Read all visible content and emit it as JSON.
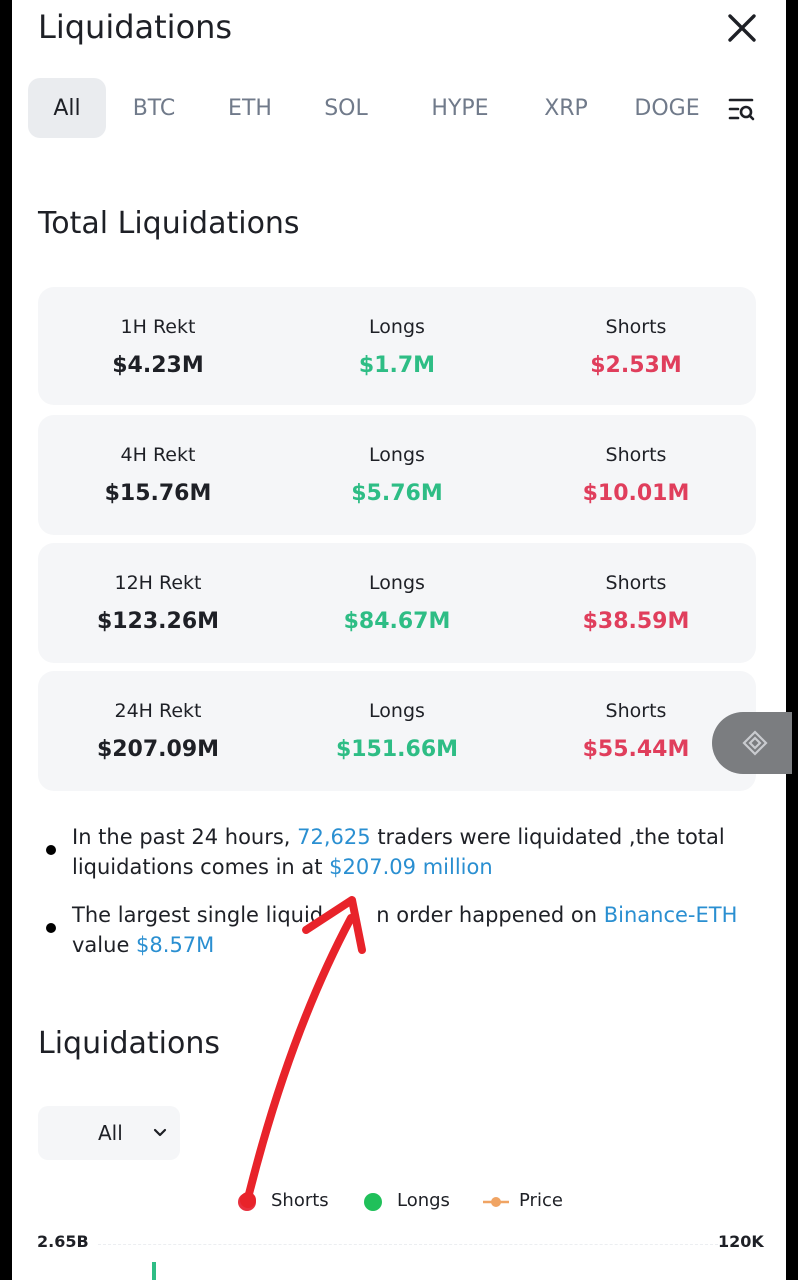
{
  "header": {
    "title": "Liquidations"
  },
  "tabs": [
    {
      "label": "All",
      "active": true
    },
    {
      "label": "BTC"
    },
    {
      "label": "ETH"
    },
    {
      "label": "SOL"
    },
    {
      "label": "HYPE"
    },
    {
      "label": "XRP"
    },
    {
      "label": "DOGE"
    }
  ],
  "total": {
    "title": "Total Liquidations",
    "rows": [
      {
        "rekt_label": "1H Rekt",
        "rekt_value": "$4.23M",
        "longs_label": "Longs",
        "longs_value": "$1.7M",
        "shorts_label": "Shorts",
        "shorts_value": "$2.53M"
      },
      {
        "rekt_label": "4H Rekt",
        "rekt_value": "$15.76M",
        "longs_label": "Longs",
        "longs_value": "$5.76M",
        "shorts_label": "Shorts",
        "shorts_value": "$10.01M"
      },
      {
        "rekt_label": "12H Rekt",
        "rekt_value": "$123.26M",
        "longs_label": "Longs",
        "longs_value": "$84.67M",
        "shorts_label": "Shorts",
        "shorts_value": "$38.59M"
      },
      {
        "rekt_label": "24H Rekt",
        "rekt_value": "$207.09M",
        "longs_label": "Longs",
        "longs_value": "$151.66M",
        "shorts_label": "Shorts",
        "shorts_value": "$55.44M"
      }
    ]
  },
  "summary": {
    "line1_pre": "In the past 24 hours, ",
    "line1_traders": "72,625",
    "line1_mid": " traders were liquidated ,the total liquidations comes in at ",
    "line1_amount": "$207.09 million",
    "line2_pre": "The largest single liquid",
    "line2_hidden": "ation",
    "line2_mid": "n order happened on ",
    "line2_exchange": "Binance-ETH",
    "line2_value_label": " value ",
    "line2_value": "$8.57M"
  },
  "chart_section": {
    "title": "Liquidations",
    "dropdown_value": "All",
    "legend": [
      {
        "label": "Shorts",
        "color": "#e8303e"
      },
      {
        "label": "Longs",
        "color": "#20c05a"
      },
      {
        "label": "Price",
        "color": "#f0a463"
      }
    ],
    "left_axis_top": "2.65B",
    "right_axis_top": "120K"
  },
  "colors": {
    "green": "#2ebd85",
    "red": "#e03e5c",
    "link": "#2a8fd1",
    "annotation_arrow": "#e8232a"
  },
  "icons": {
    "close": "close-icon",
    "filter": "filter-search-icon",
    "side_button": "binance-logo-icon",
    "dropdown": "chevron-down-icon"
  }
}
